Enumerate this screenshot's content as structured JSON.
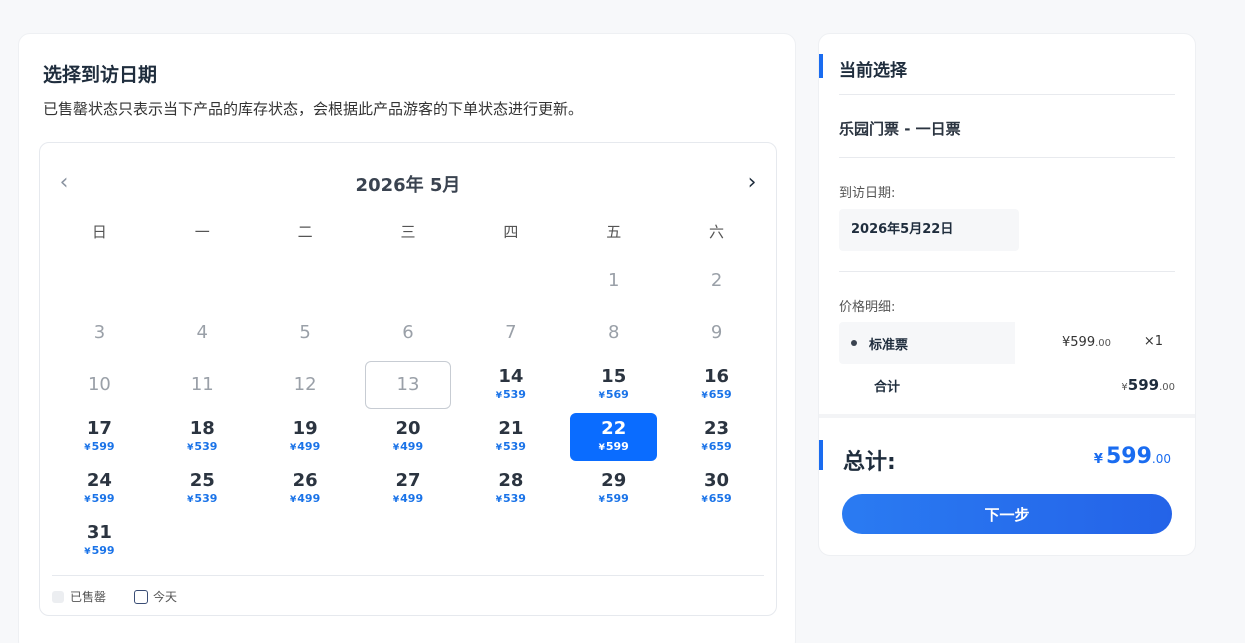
{
  "booking": {
    "title": "选择到访日期",
    "description": "已售罄状态只表示当下产品的库存状态，会根据此产品游客的下单状态进行更新。"
  },
  "calendar": {
    "month_label": "2026年 5月",
    "prev_icon": "chevron-left-icon",
    "next_icon": "chevron-right-icon",
    "weekdays": [
      "日",
      "一",
      "二",
      "三",
      "四",
      "五",
      "六"
    ],
    "currency_symbol": "¥",
    "leading_blanks": 5,
    "days": [
      {
        "day": "1",
        "price": ""
      },
      {
        "day": "2",
        "price": ""
      },
      {
        "day": "3",
        "price": ""
      },
      {
        "day": "4",
        "price": ""
      },
      {
        "day": "5",
        "price": ""
      },
      {
        "day": "6",
        "price": ""
      },
      {
        "day": "7",
        "price": ""
      },
      {
        "day": "8",
        "price": ""
      },
      {
        "day": "9",
        "price": ""
      },
      {
        "day": "10",
        "price": ""
      },
      {
        "day": "11",
        "price": ""
      },
      {
        "day": "12",
        "price": ""
      },
      {
        "day": "13",
        "price": "",
        "today": true
      },
      {
        "day": "14",
        "price": "539"
      },
      {
        "day": "15",
        "price": "569"
      },
      {
        "day": "16",
        "price": "659"
      },
      {
        "day": "17",
        "price": "599"
      },
      {
        "day": "18",
        "price": "539"
      },
      {
        "day": "19",
        "price": "499"
      },
      {
        "day": "20",
        "price": "499"
      },
      {
        "day": "21",
        "price": "539"
      },
      {
        "day": "22",
        "price": "599",
        "selected": true
      },
      {
        "day": "23",
        "price": "659"
      },
      {
        "day": "24",
        "price": "599"
      },
      {
        "day": "25",
        "price": "539"
      },
      {
        "day": "26",
        "price": "499"
      },
      {
        "day": "27",
        "price": "499"
      },
      {
        "day": "28",
        "price": "539"
      },
      {
        "day": "29",
        "price": "599"
      },
      {
        "day": "30",
        "price": "659"
      },
      {
        "day": "31",
        "price": "599"
      }
    ],
    "legend": {
      "sold_out": "已售罄",
      "today": "今天"
    }
  },
  "summary": {
    "title": "当前选择",
    "product": "乐园门票 - 一日票",
    "visit_date_label": "到访日期:",
    "visit_date": "2026年5月22日",
    "price_detail_label": "价格明细:",
    "ticket_name": "标准票",
    "ticket_price": "¥599",
    "ticket_price_dec": ".00",
    "ticket_qty": "×1",
    "subtotal_label": "合计",
    "subtotal_prefix": "¥",
    "subtotal_value": "599",
    "subtotal_dec": ".00",
    "total_label": "总计:",
    "total_currency": "¥",
    "total_value": "599",
    "total_dec": ".00",
    "next_button": "下一步"
  },
  "colors": {
    "accent": "#1a6cf0",
    "selected_day": "#0a6cff",
    "price_blue": "#1a73e8"
  }
}
